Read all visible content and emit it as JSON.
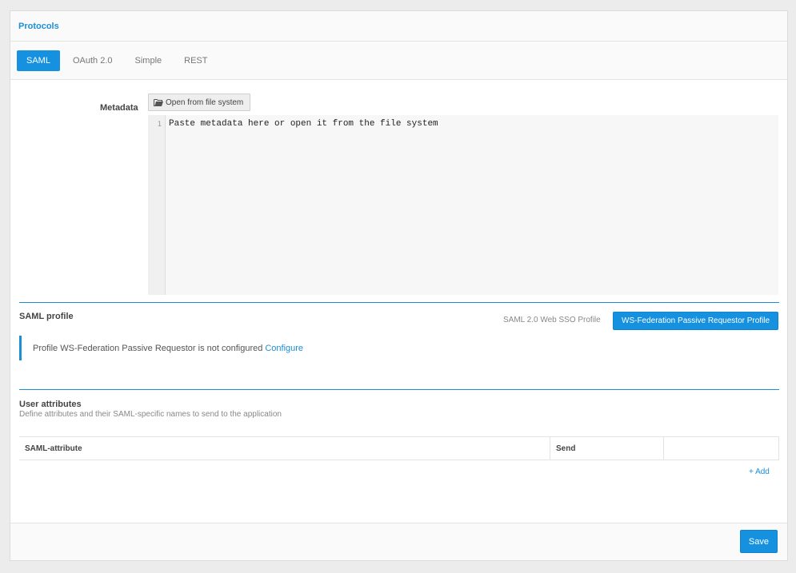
{
  "panel": {
    "title": "Protocols"
  },
  "tabs": [
    {
      "label": "SAML",
      "active": true
    },
    {
      "label": "OAuth 2.0",
      "active": false
    },
    {
      "label": "Simple",
      "active": false
    },
    {
      "label": "REST",
      "active": false
    }
  ],
  "metadata": {
    "label": "Metadata",
    "open_button_label": "Open from file system",
    "line_number": "1",
    "placeholder": "Paste metadata here or open it from the file system"
  },
  "saml_profile": {
    "title": "SAML profile",
    "option_standard": "SAML 2.0 Web SSO Profile",
    "option_selected": "WS-Federation Passive Requestor Profile",
    "notice_text": "Profile WS-Federation Passive Requestor is not configured",
    "configure_link": "Configure"
  },
  "user_attributes": {
    "title": "User attributes",
    "subtitle": "Define attributes and their SAML-specific names to send to the application",
    "columns": [
      "SAML-attribute",
      "Send",
      ""
    ],
    "add_label": "+ Add"
  },
  "footer": {
    "save_label": "Save"
  },
  "colors": {
    "accent": "#1591df",
    "link": "#1a8fd6"
  }
}
